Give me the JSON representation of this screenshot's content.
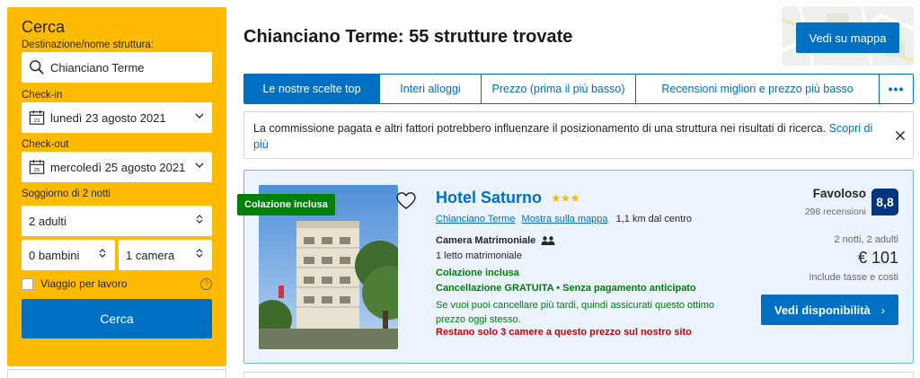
{
  "search": {
    "title": "Cerca",
    "destination_label": "Destinazione/nome struttura:",
    "destination_value": "Chianciano Terme",
    "checkin_label": "Check-in",
    "checkin_value": "lunedì 23 agosto 2021",
    "checkin_day": "23",
    "checkout_label": "Check-out",
    "checkout_value": "mercoledì 25 agosto 2021",
    "checkout_day": "25",
    "stay_label": "Soggiorno di 2 notti",
    "adults": "2 adulti",
    "children": "0 bambini",
    "rooms": "1 camera",
    "business_label": "Viaggio per lavoro",
    "help_glyph": "?",
    "button_label": "Cerca"
  },
  "results": {
    "title": "Chianciano Terme: 55 strutture trovate",
    "map_button": "Vedi su mappa",
    "tabs": [
      {
        "label": "Le nostre scelte top",
        "active": true
      },
      {
        "label": "Interi alloggi",
        "active": false
      },
      {
        "label": "Prezzo (prima il più basso)",
        "active": false
      },
      {
        "label": "Recensioni migliori e prezzo più basso",
        "active": false
      }
    ],
    "more_tab": "•••",
    "notice_text": "La commissione pagata e altri fattori potrebbero influenzare il posizionamento di una struttura nei risultati di ricerca.",
    "notice_link": "Scopri di più"
  },
  "hotel": {
    "ribbon": "Colazione inclusa",
    "name": "Hotel Saturno",
    "stars": "★★★",
    "location_link": "Chianciano Terme",
    "map_link": "Mostra sulla mappa",
    "distance": "1,1 km dal centro",
    "room_type": "Camera Matrimoniale",
    "bed": "1 letto matrimoniale",
    "breakfast": "Colazione inclusa",
    "cancellation": "Cancellazione GRATUITA • Senza pagamento anticipato",
    "cancel_note": "Se vuoi puoi cancellare più tardi, quindi assicurati questo ottimo prezzo oggi stesso.",
    "scarcity": "Restano solo 3 camere a questo prezzo sul nostro sito",
    "rating_word": "Favoloso",
    "review_count": "298 recensioni",
    "score": "8,8",
    "nights_guests": "2 notti, 2 adulti",
    "price": "€ 101",
    "taxes": "Include tasse e costi",
    "availability_button": "Vedi disponibilità",
    "availability_arrow": "›"
  },
  "colors": {
    "brand_blue": "#0071c2",
    "search_yellow": "#febb02",
    "score_navy": "#003580",
    "green": "#008009",
    "red": "#cc0000"
  }
}
